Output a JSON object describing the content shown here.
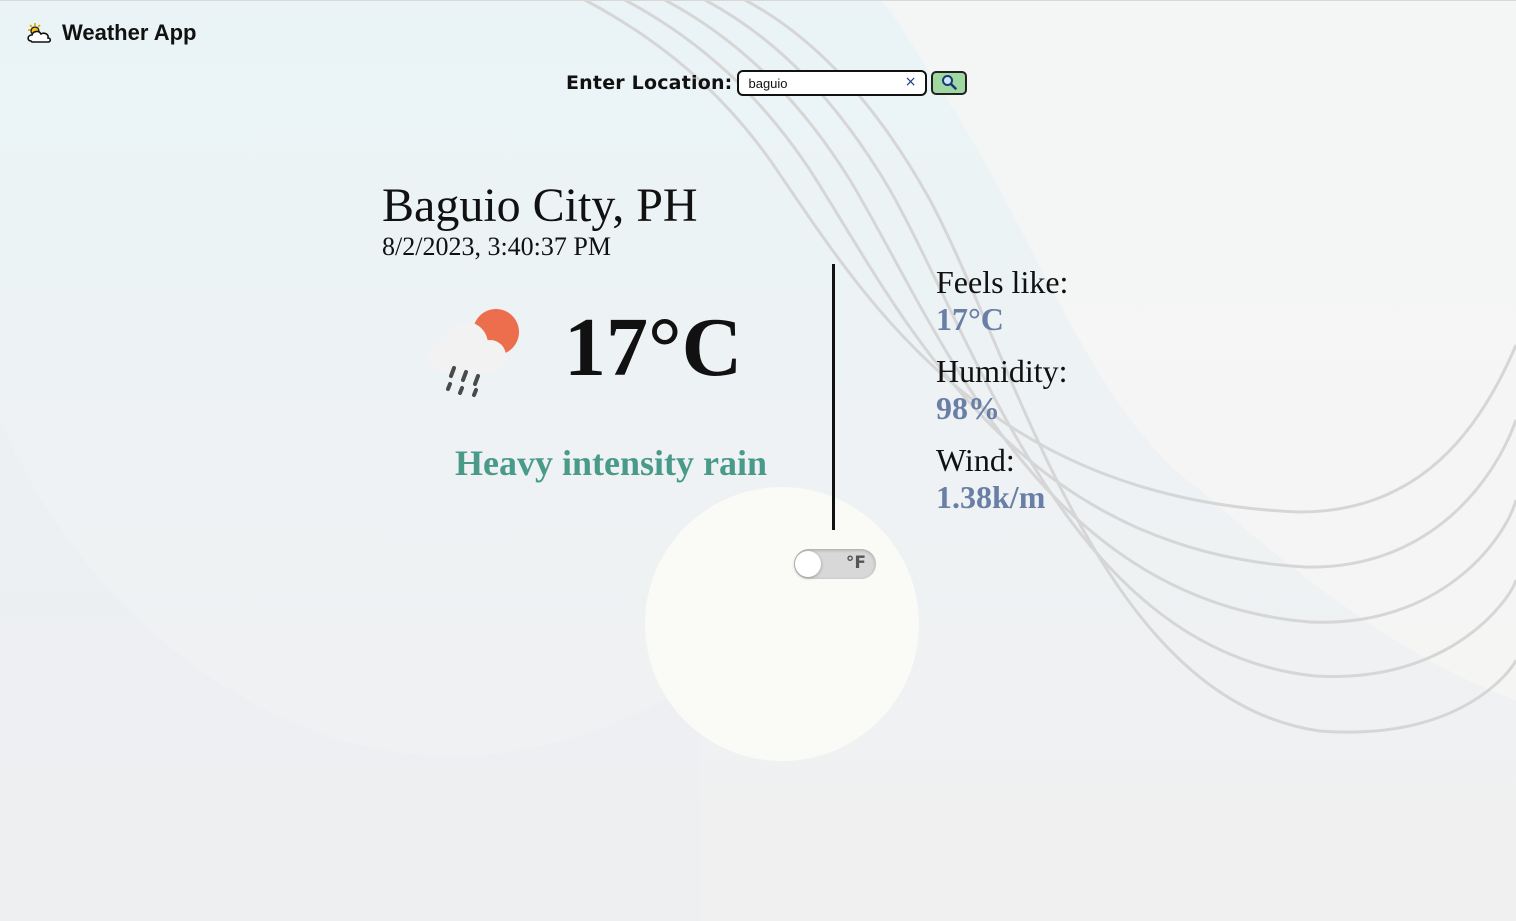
{
  "app": {
    "title": "Weather App",
    "icon": "cloud-sun-icon"
  },
  "search": {
    "label": "Enter Location:",
    "value": "baguio",
    "clear_icon": "close-icon",
    "clear_glyph": "×",
    "button_icon": "magnifier-icon"
  },
  "location": {
    "city": "Baguio City, PH",
    "datetime": "8/2/2023, 3:40:37 PM"
  },
  "current": {
    "icon": "rain-cloud-sun-icon",
    "temperature": "17°C",
    "description": "Heavy intensity rain"
  },
  "details": {
    "feels_like_label": "Feels like:",
    "feels_like_value": "17°C",
    "humidity_label": "Humidity:",
    "humidity_value": "98%",
    "wind_label": "Wind:",
    "wind_value": "1.38k/m"
  },
  "unit_toggle": {
    "label": "°F",
    "checked": false
  },
  "colors": {
    "accent_green": "#4a9a8a",
    "value_blue": "#6a7fa6",
    "search_button": "#9fd8a0",
    "sun_orange": "#ec6e4c"
  }
}
